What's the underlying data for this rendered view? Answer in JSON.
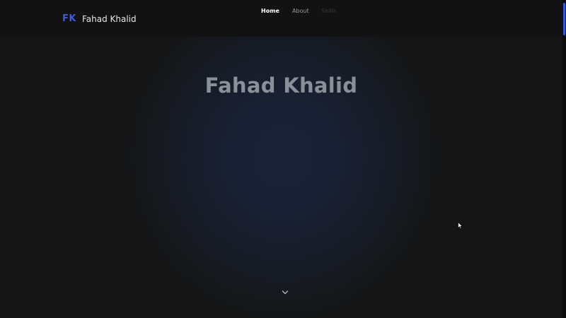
{
  "header": {
    "logo_mark": "FK",
    "logo_name": "Fahad Khalid",
    "nav": [
      {
        "label": "Home",
        "state": "active"
      },
      {
        "label": "About",
        "state": "normal"
      },
      {
        "label": "Skills",
        "state": "faded"
      }
    ]
  },
  "hero": {
    "title": "Fahad Khalid",
    "scroll_icon": "chevron-down-icon"
  },
  "colors": {
    "accent": "#3b5bdb",
    "background": "#151515",
    "hero_glow": "#1a2338"
  }
}
